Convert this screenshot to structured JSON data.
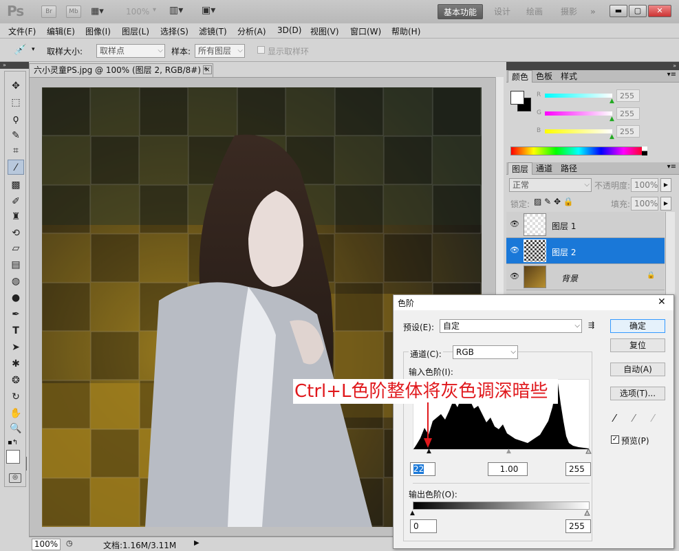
{
  "titlebar": {
    "logo": "Ps",
    "br": "Br",
    "mb": "Mb",
    "zoom": "100%",
    "workspaces": [
      "基本功能",
      "设计",
      "绘画",
      "摄影"
    ],
    "more": "»"
  },
  "menu": [
    "文件(F)",
    "编辑(E)",
    "图像(I)",
    "图层(L)",
    "选择(S)",
    "滤镜(T)",
    "分析(A)",
    "3D(D)",
    "视图(V)",
    "窗口(W)",
    "帮助(H)"
  ],
  "options": {
    "sample_size_label": "取样大小:",
    "sample_size_value": "取样点",
    "sample_label": "样本:",
    "sample_value": "所有图层",
    "show_ring": "显示取样环"
  },
  "document": {
    "tab_title": "六小灵童PS.jpg @ 100% (图层 2, RGB/8#) *",
    "close": "×"
  },
  "status": {
    "zoom": "100%",
    "docinfo": "文档:1.16M/3.11M"
  },
  "color_panel": {
    "tabs": [
      "颜色",
      "色板",
      "样式"
    ],
    "r_label": "R",
    "g_label": "G",
    "b_label": "B",
    "r": "255",
    "g": "255",
    "b": "255"
  },
  "layers_panel": {
    "tabs": [
      "图层",
      "通道",
      "路径"
    ],
    "blend": "正常",
    "opacity_label": "不透明度:",
    "opacity": "100%",
    "lock_label": "锁定:",
    "fill_label": "填充:",
    "fill": "100%",
    "layers": [
      {
        "name": "图层 1"
      },
      {
        "name": "图层 2"
      },
      {
        "name": "背景"
      }
    ]
  },
  "dialog": {
    "title": "色阶",
    "preset_label": "预设(E):",
    "preset_value": "自定",
    "channel_label": "通道(C):",
    "channel_value": "RGB",
    "input_label": "输入色阶(I):",
    "input_black": "22",
    "input_gamma": "1.00",
    "input_white": "255",
    "output_label": "输出色阶(O):",
    "output_black": "0",
    "output_white": "255",
    "ok": "确定",
    "reset": "复位",
    "auto": "自动(A)",
    "options": "选项(T)...",
    "preview": "预览(P)",
    "close": "✕"
  },
  "annotation": {
    "text": "Ctrl+L色阶整体将灰色调深暗些",
    "color": "#e0181c"
  },
  "colors": {
    "accent": "#1a78d8",
    "panel": "#d4d4d4"
  }
}
